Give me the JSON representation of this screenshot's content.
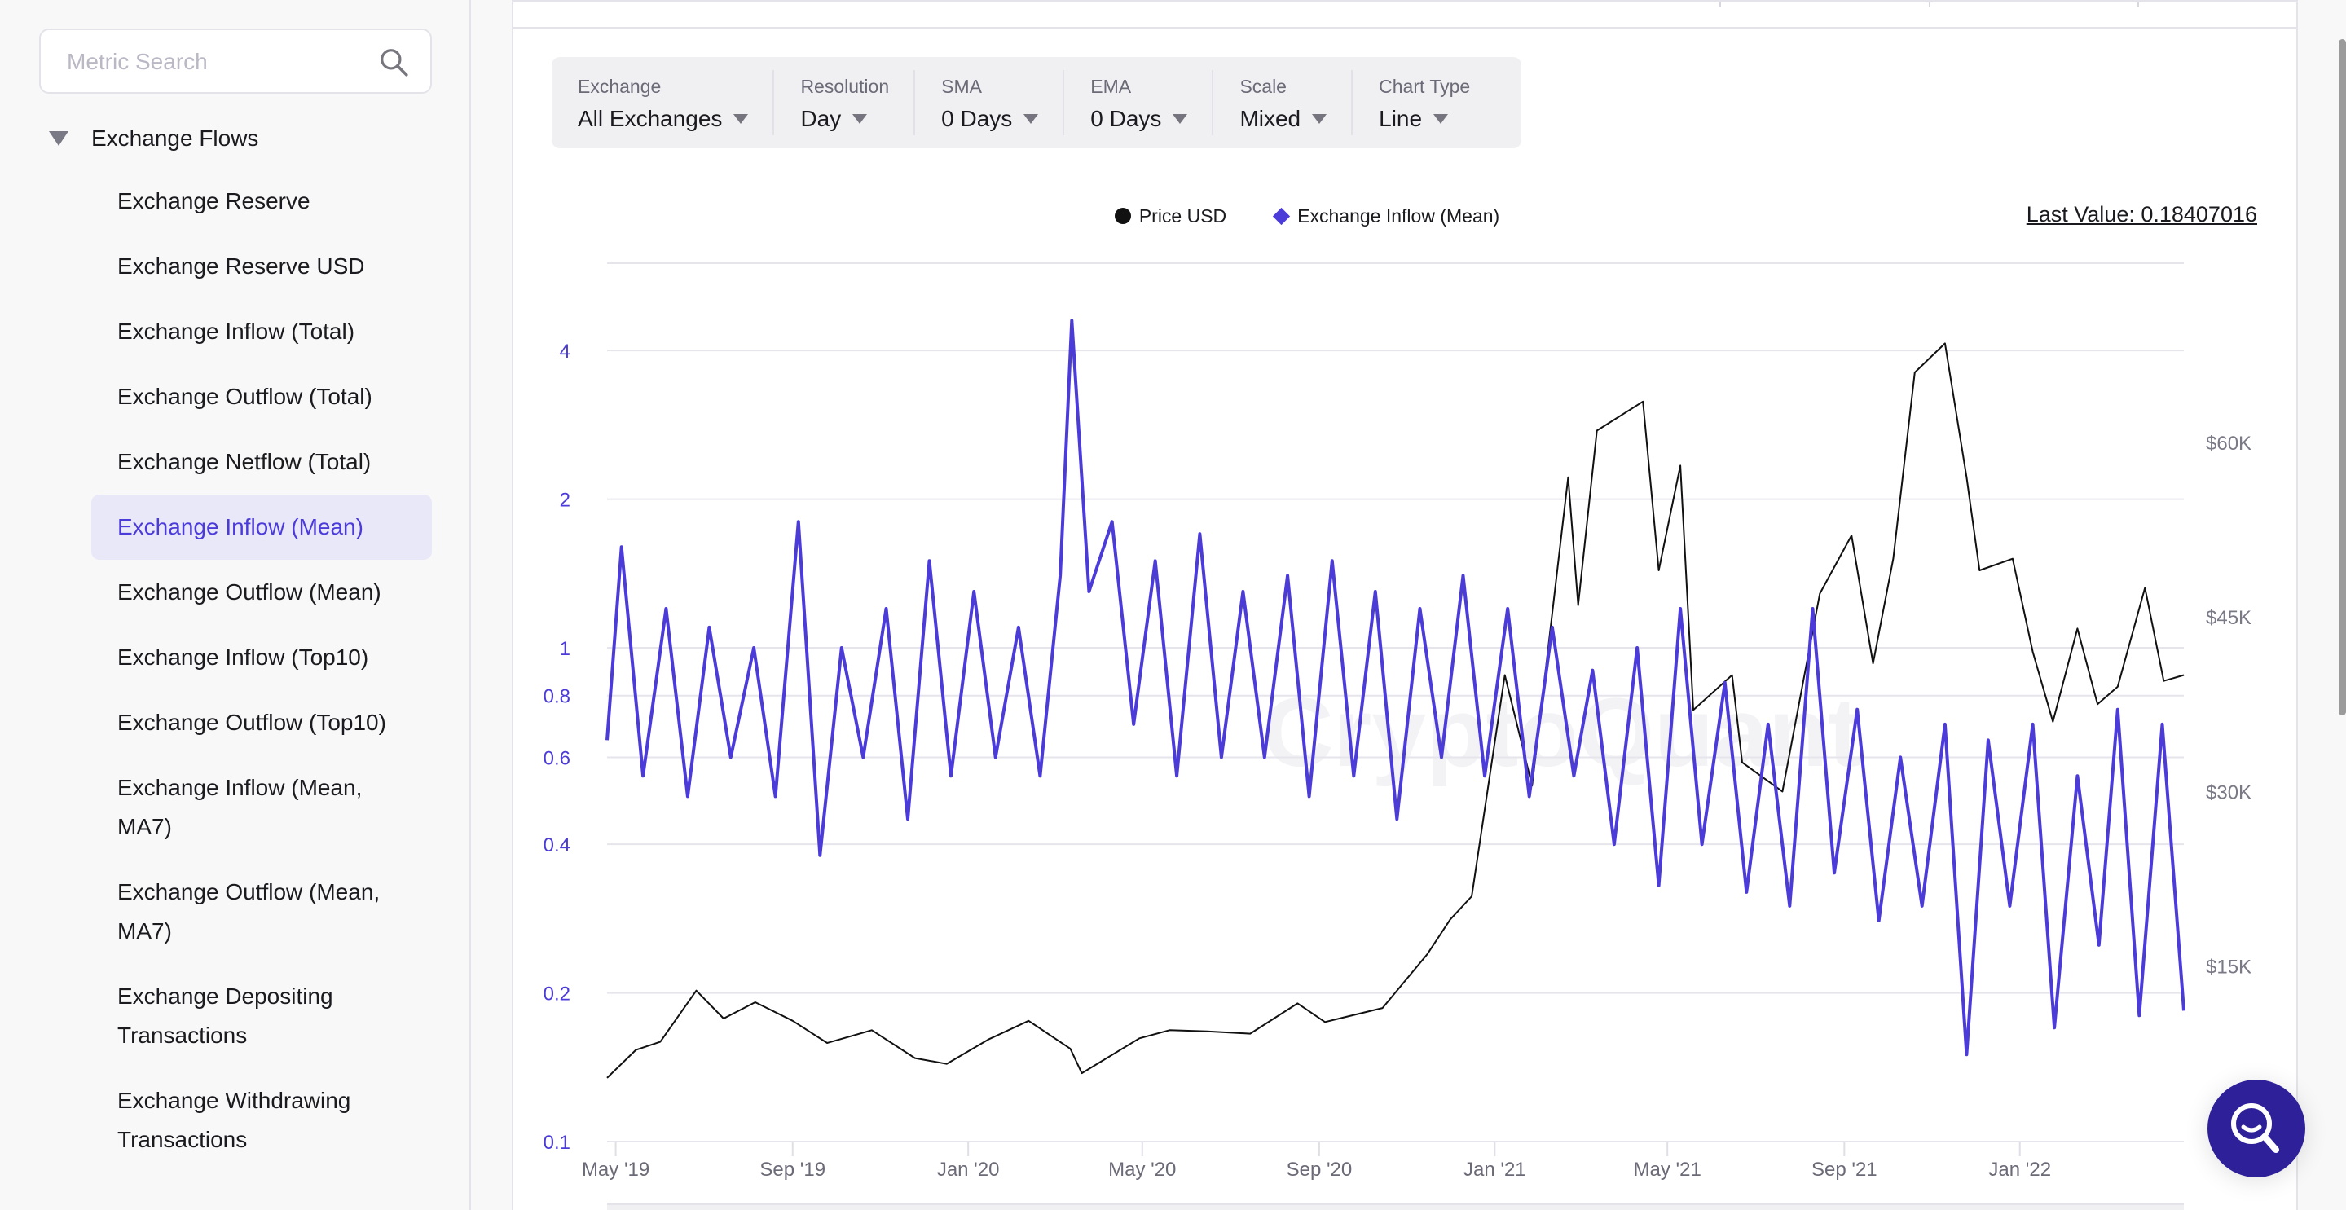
{
  "sidebar": {
    "search_placeholder": "Metric Search",
    "search_icon": "search-icon",
    "group": {
      "label": "Exchange Flows",
      "expanded": true,
      "icon": "caret-down-icon"
    },
    "items": [
      {
        "label": "Exchange Reserve",
        "active": false
      },
      {
        "label": "Exchange Reserve USD",
        "active": false
      },
      {
        "label": "Exchange Inflow (Total)",
        "active": false
      },
      {
        "label": "Exchange Outflow (Total)",
        "active": false
      },
      {
        "label": "Exchange Netflow (Total)",
        "active": false
      },
      {
        "label": "Exchange Inflow (Mean)",
        "active": true
      },
      {
        "label": "Exchange Outflow (Mean)",
        "active": false
      },
      {
        "label": "Exchange Inflow (Top10)",
        "active": false
      },
      {
        "label": "Exchange Outflow (Top10)",
        "active": false
      },
      {
        "label": "Exchange Inflow (Mean, MA7)",
        "active": false
      },
      {
        "label": "Exchange Outflow (Mean, MA7)",
        "active": false
      },
      {
        "label": "Exchange Depositing Transactions",
        "active": false
      },
      {
        "label": "Exchange Withdrawing Transactions",
        "active": false
      }
    ]
  },
  "toolbar": [
    {
      "label": "Exchange",
      "value": "All Exchanges"
    },
    {
      "label": "Resolution",
      "value": "Day"
    },
    {
      "label": "SMA",
      "value": "0 Days"
    },
    {
      "label": "EMA",
      "value": "0 Days"
    },
    {
      "label": "Scale",
      "value": "Mixed"
    },
    {
      "label": "Chart Type",
      "value": "Line"
    }
  ],
  "legend": [
    {
      "label": "Price USD",
      "marker": "circle",
      "color": "#111111"
    },
    {
      "label": "Exchange Inflow (Mean)",
      "marker": "diamond",
      "color": "#4b3bd9"
    }
  ],
  "last_value": "Last Value: 0.18407016",
  "watermark": "CryptoQuant",
  "fab_icon": "search-assistant-icon",
  "colors": {
    "accent": "#4b3bd9",
    "price": "#111111",
    "fab": "#2e2099",
    "active_bg": "#e9e8f8"
  },
  "chart_data": {
    "type": "line",
    "title": "",
    "xlabel": "",
    "x_ticks": [
      "May '19",
      "Sep '19",
      "Jan '20",
      "May '20",
      "Sep '20",
      "Jan '21",
      "May '21",
      "Sep '21",
      "Jan '22"
    ],
    "x_range": [
      "2019-04-25",
      "2022-04-25"
    ],
    "left_axis": {
      "scale": "log",
      "ticks": [
        0.1,
        0.2,
        0.4,
        0.6,
        0.8,
        1,
        2,
        4
      ],
      "tick_labels": [
        "0.1",
        "0.2",
        "0.4",
        "0.6",
        "0.8",
        "1",
        "2",
        "4"
      ],
      "range": [
        0.1,
        5.5
      ],
      "color": "#4b3bd9"
    },
    "right_axis": {
      "scale": "linear",
      "ticks": [
        15000,
        30000,
        45000,
        60000
      ],
      "tick_labels": [
        "$15K",
        "$30K",
        "$45K",
        "$60K"
      ],
      "range": [
        0,
        82000
      ]
    },
    "grid": true,
    "legend_position": "top-center",
    "series": [
      {
        "name": "Price USD",
        "axis": "right",
        "color": "#111111",
        "x": [
          "2019-04-25",
          "2019-05-15",
          "2019-06-01",
          "2019-06-26",
          "2019-07-15",
          "2019-08-06",
          "2019-09-01",
          "2019-09-25",
          "2019-10-26",
          "2019-11-25",
          "2019-12-17",
          "2020-01-15",
          "2020-02-12",
          "2020-03-12",
          "2020-03-20",
          "2020-04-29",
          "2020-05-20",
          "2020-06-15",
          "2020-07-15",
          "2020-08-17",
          "2020-09-05",
          "2020-10-15",
          "2020-11-15",
          "2020-12-01",
          "2020-12-16",
          "2021-01-08",
          "2021-01-27",
          "2021-02-21",
          "2021-02-28",
          "2021-03-13",
          "2021-04-14",
          "2021-04-25",
          "2021-05-10",
          "2021-05-19",
          "2021-06-15",
          "2021-06-22",
          "2021-07-20",
          "2021-08-15",
          "2021-09-06",
          "2021-09-21",
          "2021-10-05",
          "2021-10-20",
          "2021-11-10",
          "2021-11-25",
          "2021-12-04",
          "2021-12-27",
          "2022-01-10",
          "2022-01-24",
          "2022-02-10",
          "2022-02-24",
          "2022-03-10",
          "2022-03-29",
          "2022-04-11",
          "2022-04-25"
        ],
        "values": [
          5400,
          7800,
          8500,
          12900,
          10500,
          11900,
          10300,
          8400,
          9500,
          7100,
          6600,
          8700,
          10300,
          7900,
          5800,
          8800,
          9500,
          9400,
          9200,
          11800,
          10200,
          11400,
          16000,
          19000,
          21000,
          40000,
          30500,
          57000,
          46000,
          61000,
          63500,
          49000,
          58000,
          37000,
          40000,
          32500,
          30000,
          47000,
          52000,
          41000,
          50000,
          66000,
          68500,
          57000,
          49000,
          50000,
          42000,
          36000,
          44000,
          37500,
          39000,
          47500,
          39500,
          40000
        ]
      },
      {
        "name": "Exchange Inflow (Mean)",
        "axis": "left",
        "color": "#4b3bd9",
        "x": [
          "2019-04-25",
          "2019-05-05",
          "2019-05-20",
          "2019-06-05",
          "2019-06-20",
          "2019-07-05",
          "2019-07-20",
          "2019-08-05",
          "2019-08-20",
          "2019-09-05",
          "2019-09-20",
          "2019-10-05",
          "2019-10-20",
          "2019-11-05",
          "2019-11-20",
          "2019-12-05",
          "2019-12-20",
          "2020-01-05",
          "2020-01-20",
          "2020-02-05",
          "2020-02-20",
          "2020-03-05",
          "2020-03-13",
          "2020-03-25",
          "2020-04-10",
          "2020-04-25",
          "2020-05-10",
          "2020-05-25",
          "2020-06-10",
          "2020-06-25",
          "2020-07-10",
          "2020-07-25",
          "2020-08-10",
          "2020-08-25",
          "2020-09-10",
          "2020-09-25",
          "2020-10-10",
          "2020-10-25",
          "2020-11-10",
          "2020-11-25",
          "2020-12-10",
          "2020-12-25",
          "2021-01-10",
          "2021-01-25",
          "2021-02-10",
          "2021-02-25",
          "2021-03-10",
          "2021-03-25",
          "2021-04-10",
          "2021-04-25",
          "2021-05-10",
          "2021-05-25",
          "2021-06-10",
          "2021-06-25",
          "2021-07-10",
          "2021-07-25",
          "2021-08-10",
          "2021-08-25",
          "2021-09-10",
          "2021-09-25",
          "2021-10-10",
          "2021-10-25",
          "2021-11-10",
          "2021-11-25",
          "2021-12-10",
          "2021-12-25",
          "2022-01-10",
          "2022-01-25",
          "2022-02-10",
          "2022-02-25",
          "2022-03-10",
          "2022-03-25",
          "2022-04-10",
          "2022-04-25"
        ],
        "values": [
          0.65,
          1.6,
          0.55,
          1.2,
          0.5,
          1.1,
          0.6,
          1.0,
          0.5,
          1.8,
          0.38,
          1.0,
          0.6,
          1.2,
          0.45,
          1.5,
          0.55,
          1.3,
          0.6,
          1.1,
          0.55,
          1.4,
          4.6,
          1.3,
          1.8,
          0.7,
          1.5,
          0.55,
          1.7,
          0.6,
          1.3,
          0.6,
          1.4,
          0.5,
          1.5,
          0.55,
          1.3,
          0.45,
          1.2,
          0.6,
          1.4,
          0.55,
          1.2,
          0.5,
          1.1,
          0.55,
          0.9,
          0.4,
          1.0,
          0.33,
          1.2,
          0.4,
          0.85,
          0.32,
          0.7,
          0.3,
          1.2,
          0.35,
          0.75,
          0.28,
          0.6,
          0.3,
          0.7,
          0.15,
          0.65,
          0.3,
          0.7,
          0.17,
          0.55,
          0.25,
          0.75,
          0.18,
          0.7,
          0.18407016
        ]
      }
    ]
  }
}
